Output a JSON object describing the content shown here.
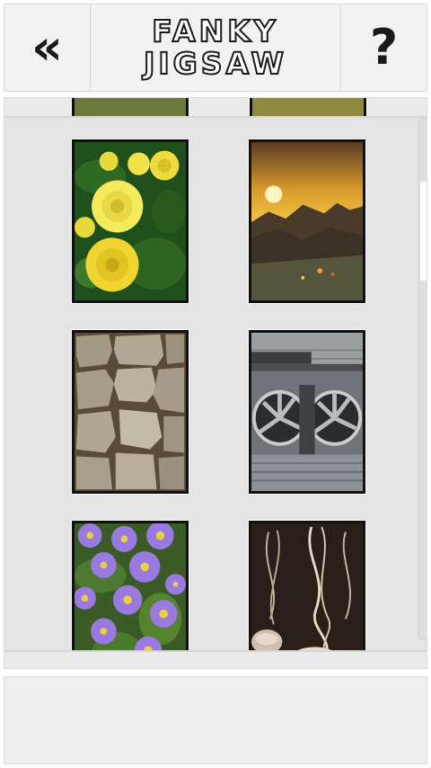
{
  "header": {
    "title_line1": "FANKY",
    "title_line2": "JIGSAW",
    "back_label": "«",
    "help_label": "?"
  },
  "puzzles": [
    {
      "subject": "partial-top-left"
    },
    {
      "subject": "partial-top-right"
    },
    {
      "subject": "yellow-roses"
    },
    {
      "subject": "mountain-sunset"
    },
    {
      "subject": "stone-wall"
    },
    {
      "subject": "industrial-fans"
    },
    {
      "subject": "purple-asters"
    },
    {
      "subject": "jellyfish"
    }
  ]
}
